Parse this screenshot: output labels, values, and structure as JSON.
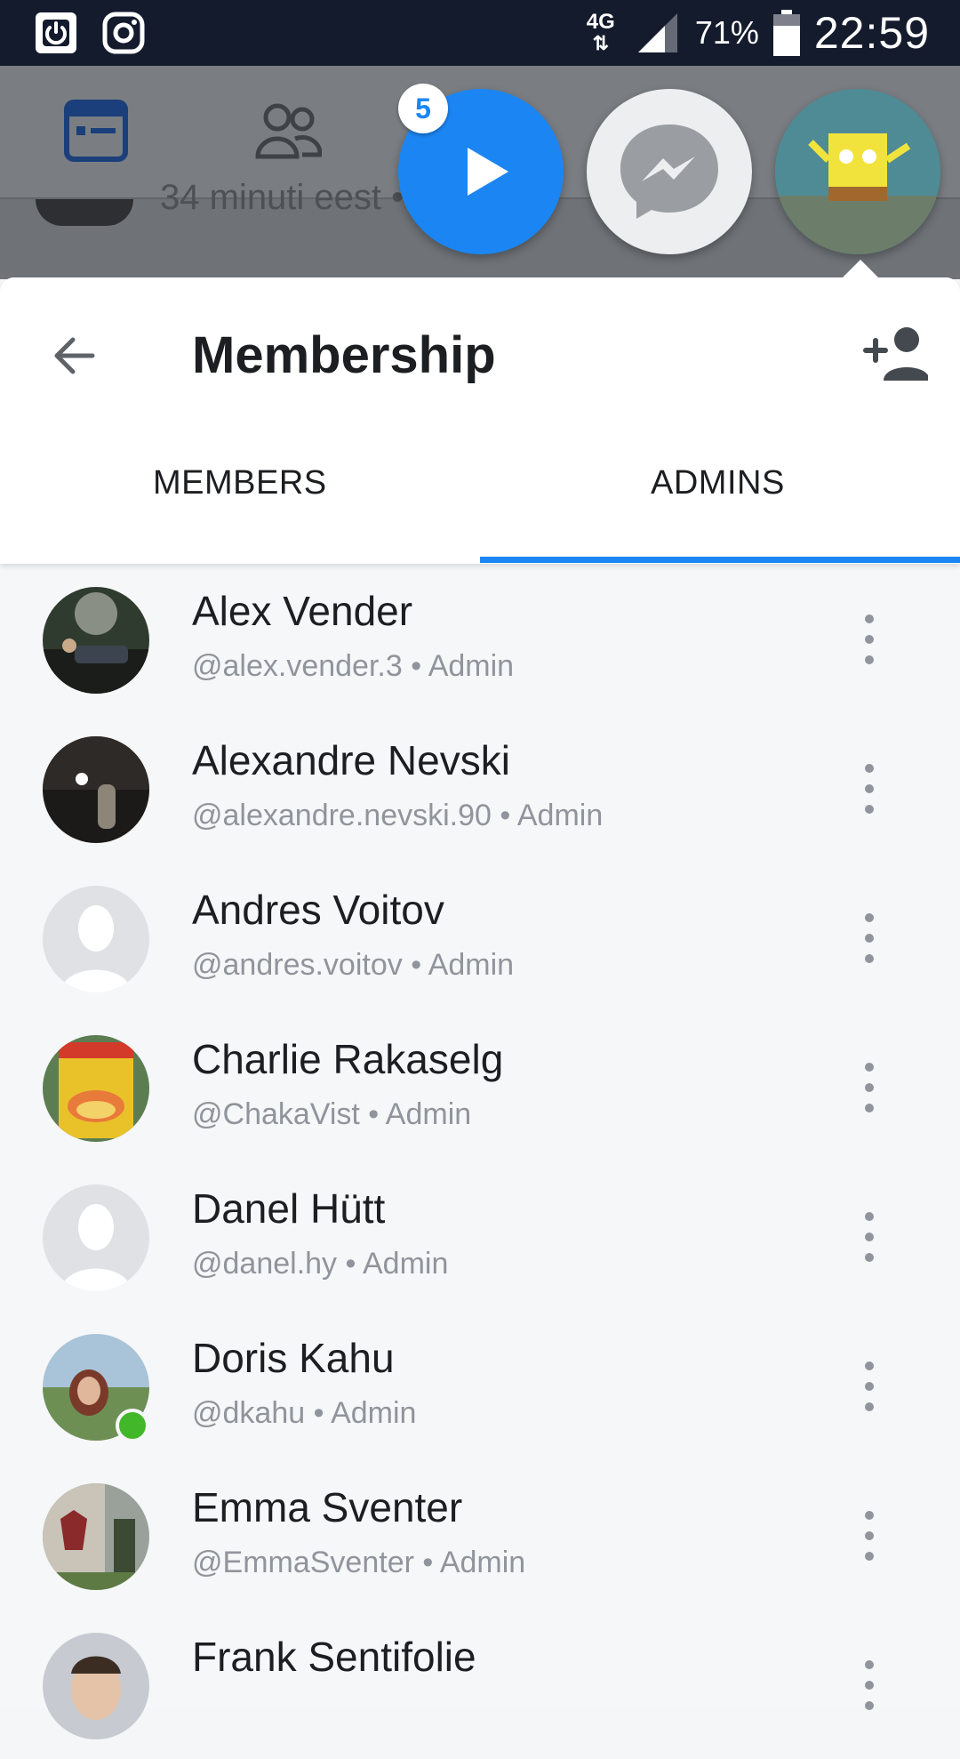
{
  "status_bar": {
    "network": "4G",
    "battery": "71%",
    "time": "22:59"
  },
  "background_app": {
    "feed_text": "34 minuti eest •"
  },
  "chat_heads": {
    "badge_count": "5"
  },
  "header": {
    "title": "Membership",
    "tabs": [
      {
        "label": "MEMBERS",
        "selected": false
      },
      {
        "label": "ADMINS",
        "selected": true
      }
    ]
  },
  "members": [
    {
      "name": "Alex Vender",
      "username": "@alex.vender.3",
      "role": "Admin",
      "online": false
    },
    {
      "name": "Alexandre Nevski",
      "username": "@alexandre.nevski.90",
      "role": "Admin",
      "online": false
    },
    {
      "name": "Andres Voitov",
      "username": "@andres.voitov",
      "role": "Admin",
      "online": false
    },
    {
      "name": "Charlie Rakaselg",
      "username": "@ChakaVist",
      "role": "Admin",
      "online": false
    },
    {
      "name": "Danel Hütt",
      "username": "@danel.hy",
      "role": "Admin",
      "online": false
    },
    {
      "name": "Doris Kahu",
      "username": "@dkahu",
      "role": "Admin",
      "online": true
    },
    {
      "name": "Emma Sventer",
      "username": "@EmmaSventer",
      "role": "Admin",
      "online": false
    },
    {
      "name": "Frank Sentifolie",
      "username": "",
      "role": "",
      "online": false
    }
  ],
  "colors": {
    "accent": "#1b86f3",
    "online": "#42b72a",
    "status_bar": "#141b2d"
  }
}
